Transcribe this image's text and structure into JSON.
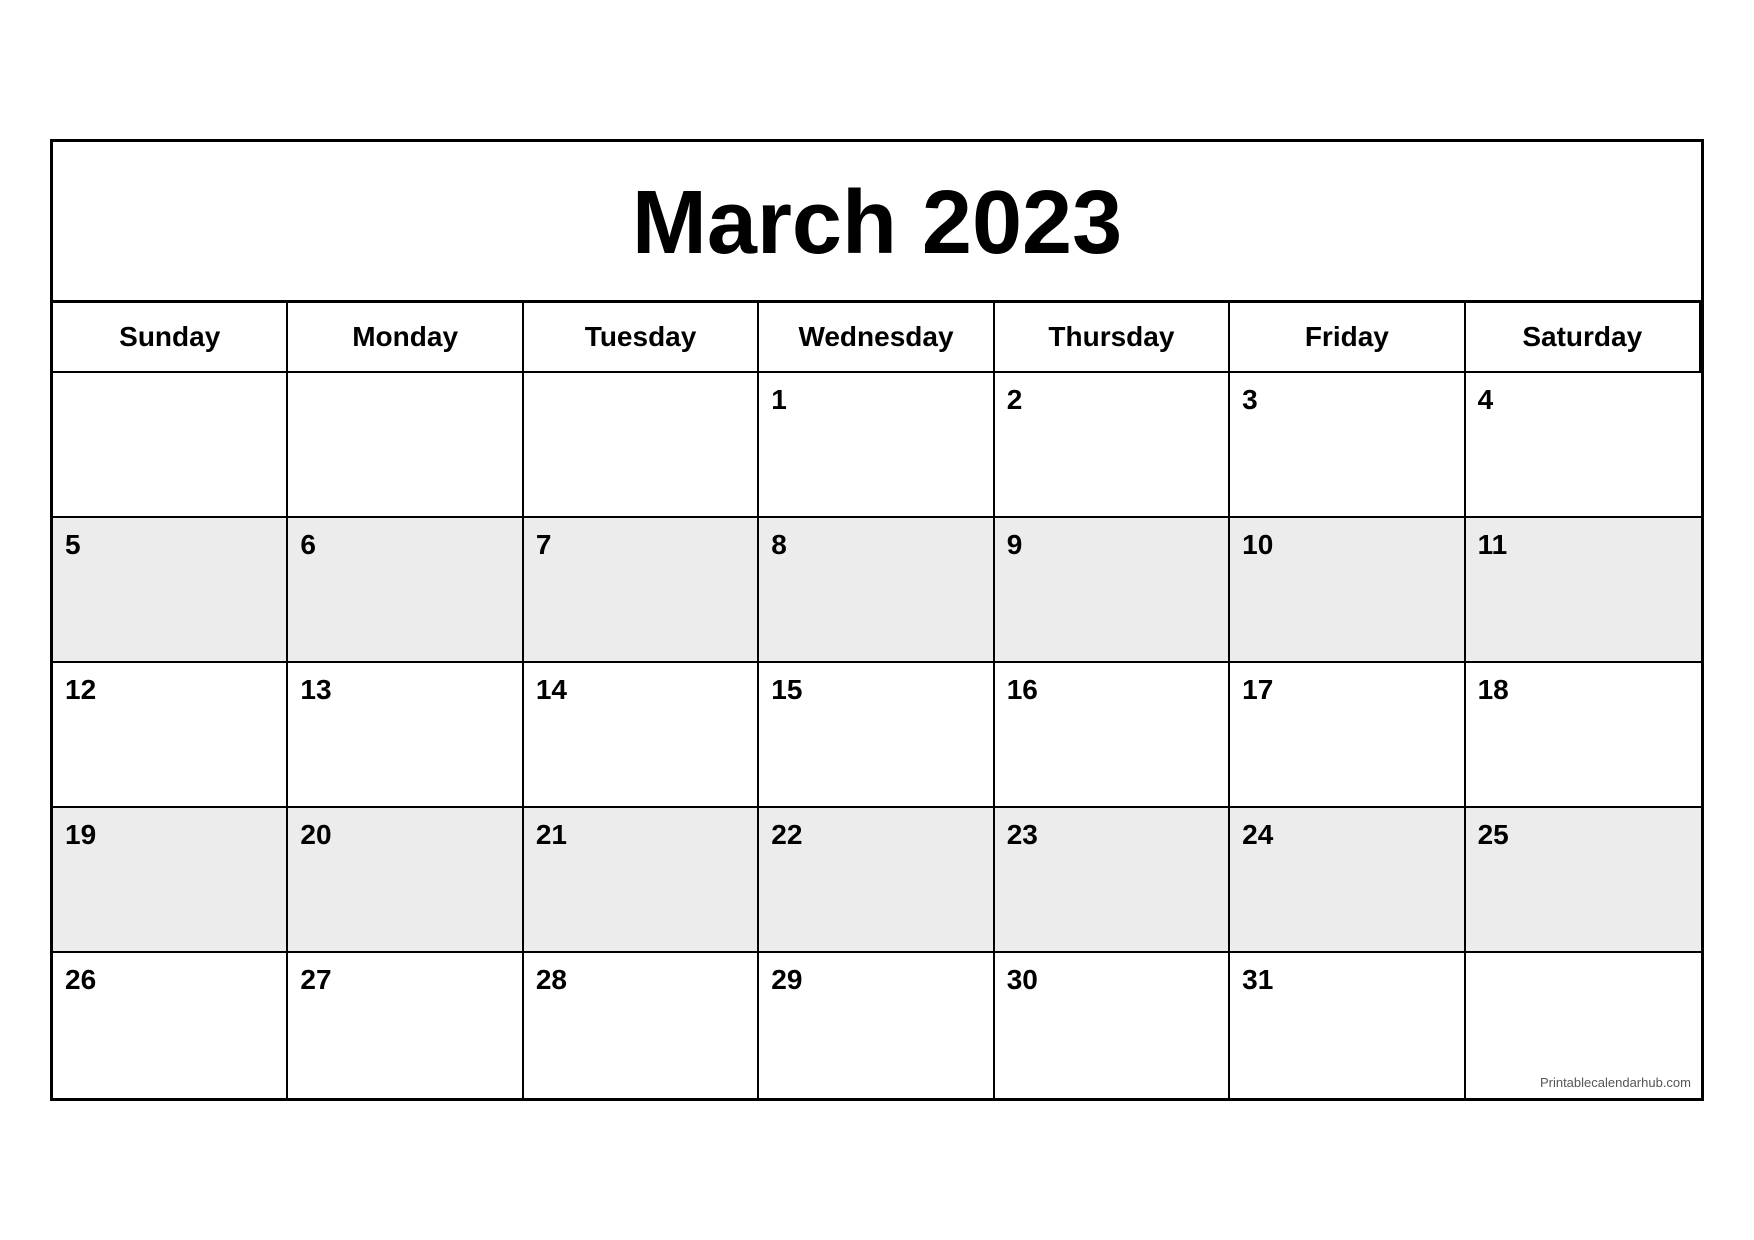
{
  "calendar": {
    "title": "March 2023",
    "headers": [
      "Sunday",
      "Monday",
      "Tuesday",
      "Wednesday",
      "Thursday",
      "Friday",
      "Saturday"
    ],
    "weeks": [
      [
        {
          "day": "",
          "empty": true,
          "shaded": false
        },
        {
          "day": "",
          "empty": true,
          "shaded": false
        },
        {
          "day": "",
          "empty": true,
          "shaded": false
        },
        {
          "day": "1",
          "empty": false,
          "shaded": false
        },
        {
          "day": "2",
          "empty": false,
          "shaded": false
        },
        {
          "day": "3",
          "empty": false,
          "shaded": false
        },
        {
          "day": "4",
          "empty": false,
          "shaded": false
        }
      ],
      [
        {
          "day": "5",
          "empty": false,
          "shaded": true,
          "bold": true
        },
        {
          "day": "6",
          "empty": false,
          "shaded": true
        },
        {
          "day": "7",
          "empty": false,
          "shaded": true
        },
        {
          "day": "8",
          "empty": false,
          "shaded": true
        },
        {
          "day": "9",
          "empty": false,
          "shaded": true
        },
        {
          "day": "10",
          "empty": false,
          "shaded": true
        },
        {
          "day": "11",
          "empty": false,
          "shaded": true
        }
      ],
      [
        {
          "day": "12",
          "empty": false,
          "shaded": false,
          "bold": true
        },
        {
          "day": "13",
          "empty": false,
          "shaded": false
        },
        {
          "day": "14",
          "empty": false,
          "shaded": false
        },
        {
          "day": "15",
          "empty": false,
          "shaded": false
        },
        {
          "day": "16",
          "empty": false,
          "shaded": false
        },
        {
          "day": "17",
          "empty": false,
          "shaded": false
        },
        {
          "day": "18",
          "empty": false,
          "shaded": false
        }
      ],
      [
        {
          "day": "19",
          "empty": false,
          "shaded": true,
          "bold": true
        },
        {
          "day": "20",
          "empty": false,
          "shaded": true
        },
        {
          "day": "21",
          "empty": false,
          "shaded": true
        },
        {
          "day": "22",
          "empty": false,
          "shaded": true
        },
        {
          "day": "23",
          "empty": false,
          "shaded": true
        },
        {
          "day": "24",
          "empty": false,
          "shaded": true
        },
        {
          "day": "25",
          "empty": false,
          "shaded": true
        }
      ],
      [
        {
          "day": "26",
          "empty": false,
          "shaded": false,
          "bold": true
        },
        {
          "day": "27",
          "empty": false,
          "shaded": false
        },
        {
          "day": "28",
          "empty": false,
          "shaded": false
        },
        {
          "day": "29",
          "empty": false,
          "shaded": false
        },
        {
          "day": "30",
          "empty": false,
          "shaded": false
        },
        {
          "day": "31",
          "empty": false,
          "shaded": false
        },
        {
          "day": "",
          "empty": true,
          "shaded": false,
          "watermark": "Printablecalendarhub.com"
        }
      ]
    ]
  }
}
